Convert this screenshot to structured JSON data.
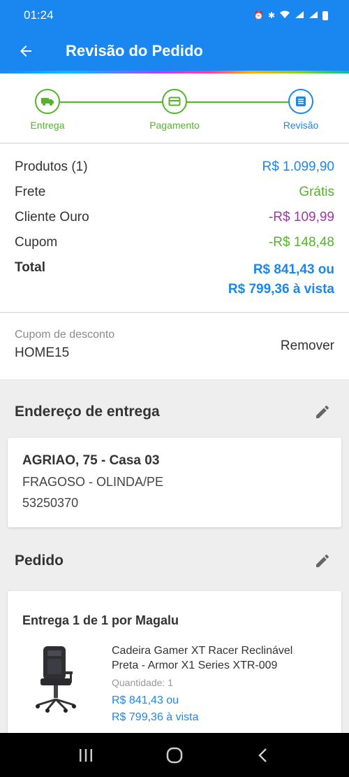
{
  "status_bar": {
    "time": "01:24"
  },
  "header": {
    "title": "Revisão do Pedido"
  },
  "stepper": {
    "steps": [
      {
        "label": "Entrega",
        "icon": "truck-icon",
        "color": "#52b52b"
      },
      {
        "label": "Pagamento",
        "icon": "card-icon",
        "color": "#52b52b"
      },
      {
        "label": "Revisão",
        "icon": "list-icon",
        "color": "#1a87f0"
      }
    ]
  },
  "summary": {
    "products_label": "Produtos (1)",
    "products_value": "R$ 1.099,90",
    "shipping_label": "Frete",
    "shipping_value": "Grátis",
    "gold_label": "Cliente Ouro",
    "gold_value": "-R$ 109,99",
    "coupon_label": "Cupom",
    "coupon_value": "-R$ 148,48",
    "total_label": "Total",
    "total_value_line1": "R$ 841,43 ou",
    "total_value_line2": "R$ 799,36 à vista"
  },
  "coupon": {
    "label": "Cupom de desconto",
    "code": "HOME15",
    "remove_label": "Remover"
  },
  "address_section": {
    "title": "Endereço de entrega",
    "line1": "AGRIAO, 75 - Casa 03",
    "line2": "FRAGOSO - OLINDA/PE",
    "line3": "53250370"
  },
  "order_section": {
    "title": "Pedido",
    "delivery_label": "Entrega 1 de 1 por Magalu",
    "product_name": "Cadeira Gamer XT Racer Reclinável Preta - Armor X1 Series XTR-009",
    "quantity_label": "Quantidade:",
    "quantity_value": "1",
    "price_line1": "R$ 841,43 ou",
    "price_line2": "R$ 799,36 à vista"
  },
  "colors": {
    "primary": "#1a87f0",
    "success": "#52b52b",
    "gold": "#9b3aa0"
  }
}
